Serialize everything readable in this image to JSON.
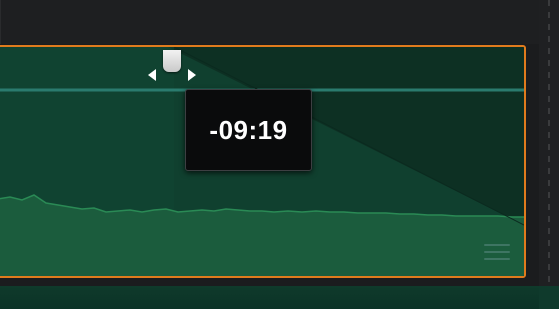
{
  "timeline": {
    "fade_tooltip": {
      "value": "-09:19"
    },
    "clip": {
      "icons": {
        "menu": "hamburger-menu-icon",
        "handle_left": "arrow-left-icon",
        "handle_right": "arrow-right-icon"
      },
      "colors": {
        "border": "#e07b1d",
        "fill": "#0d3023",
        "waveform": "#1f6e46",
        "fade_line": "#2a7b6e"
      }
    }
  }
}
